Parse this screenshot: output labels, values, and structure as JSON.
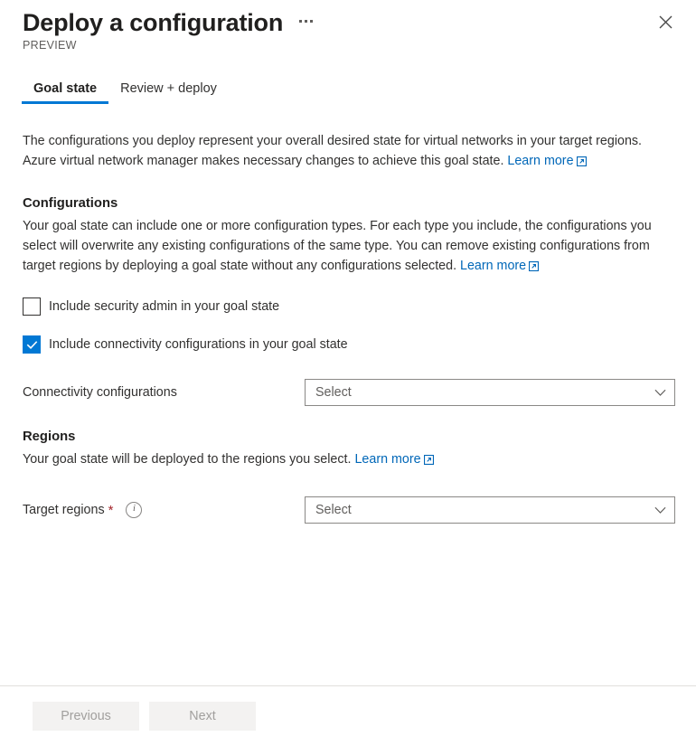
{
  "header": {
    "title": "Deploy a configuration",
    "preview_label": "PREVIEW",
    "more_icon": "ellipsis-icon",
    "close_icon": "close-icon"
  },
  "tabs": [
    {
      "label": "Goal state",
      "active": true
    },
    {
      "label": "Review + deploy",
      "active": false
    }
  ],
  "intro": {
    "text": "The configurations you deploy represent your overall desired state for virtual networks in your target regions. Azure virtual network manager makes necessary changes to achieve this goal state. ",
    "link_label": "Learn more",
    "link_icon": "external-link-icon"
  },
  "configurations": {
    "heading": "Configurations",
    "description": "Your goal state can include one or more configuration types. For each type you include, the configurations you select will overwrite any existing configurations of the same type. You can remove existing configurations from target regions by deploying a goal state without any configurations selected. ",
    "link_label": "Learn more",
    "link_icon": "external-link-icon",
    "checkboxes": [
      {
        "label": "Include security admin in your goal state",
        "checked": false
      },
      {
        "label": "Include connectivity configurations in your goal state",
        "checked": true
      }
    ],
    "connectivity_field": {
      "label": "Connectivity configurations",
      "value": "Select",
      "chevron_icon": "chevron-down-icon"
    }
  },
  "regions": {
    "heading": "Regions",
    "description": "Your goal state will be deployed to the regions you select. ",
    "link_label": "Learn more",
    "link_icon": "external-link-icon",
    "target_field": {
      "label": "Target regions",
      "required_marker": "*",
      "info_icon": "info-icon",
      "info_glyph": "i",
      "value": "Select",
      "chevron_icon": "chevron-down-icon"
    }
  },
  "footer": {
    "previous_label": "Previous",
    "next_label": "Next"
  },
  "colors": {
    "accent": "#0078d4",
    "link": "#0067b8",
    "required": "#a4262c",
    "text": "#323130",
    "muted": "#605e5c",
    "disabled_bg": "#f3f2f1",
    "disabled_text": "#a19f9d"
  }
}
